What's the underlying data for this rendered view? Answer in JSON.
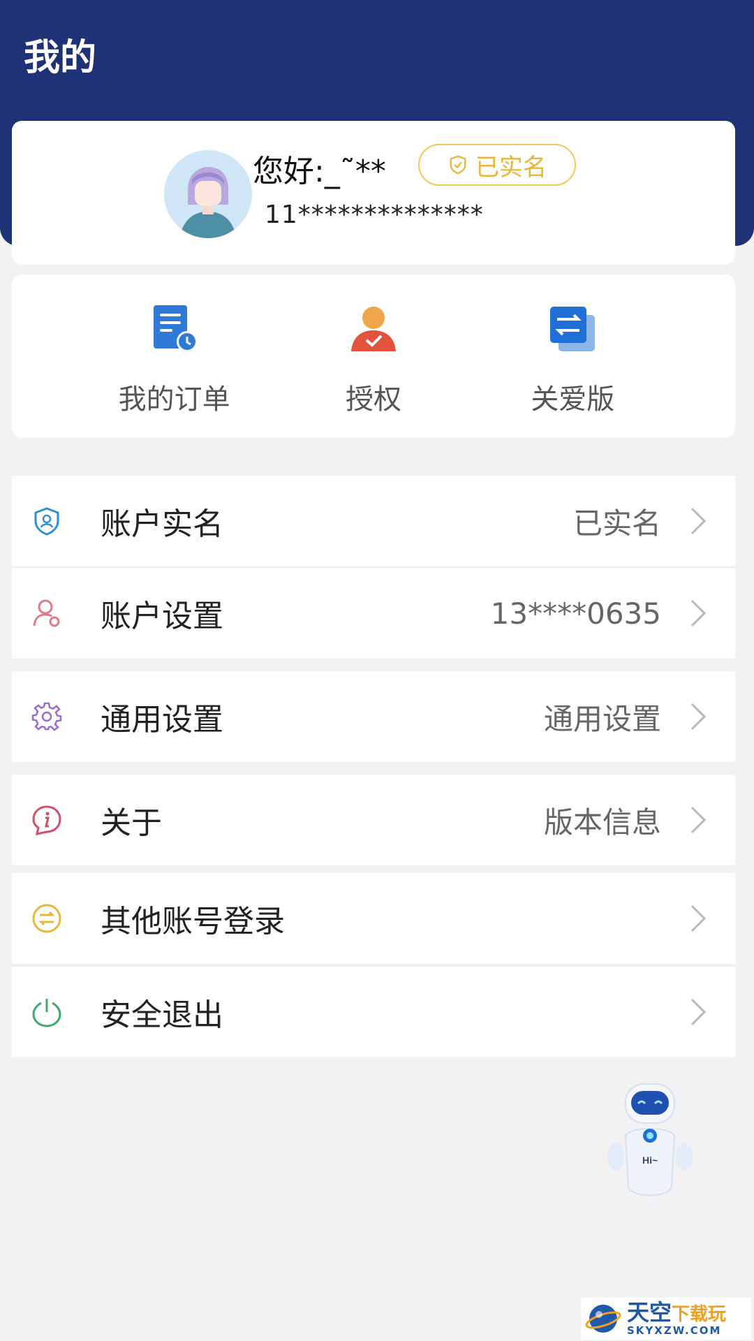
{
  "header": {
    "title": "我的"
  },
  "profile": {
    "greeting": "您好:_˜**",
    "badge_label": "已实名",
    "phone": "11**************"
  },
  "quick_actions": [
    {
      "label": "我的订单",
      "icon": "order-icon"
    },
    {
      "label": "授权",
      "icon": "authorize-user-icon"
    },
    {
      "label": "关爱版",
      "icon": "switch-version-icon"
    }
  ],
  "menu": [
    {
      "label": "账户实名",
      "value": "已实名",
      "icon": "shield-user-icon"
    },
    {
      "label": "账户设置",
      "value": "13****0635",
      "icon": "user-settings-icon"
    },
    {
      "label": "通用设置",
      "value": "通用设置",
      "icon": "gear-icon"
    },
    {
      "label": "关于",
      "value": "版本信息",
      "icon": "info-icon"
    },
    {
      "label": "其他账号登录",
      "value": "",
      "icon": "switch-account-icon"
    },
    {
      "label": "安全退出",
      "value": "",
      "icon": "power-icon"
    }
  ],
  "assistant": {
    "bubble": "Hi~"
  },
  "watermark": {
    "brand": "天空",
    "brand_accent": "下载玩",
    "domain": "SKYXZW.COM"
  },
  "colors": {
    "header": "#1e3275",
    "badge": "#f4c85a",
    "background": "#f2f2f4"
  }
}
